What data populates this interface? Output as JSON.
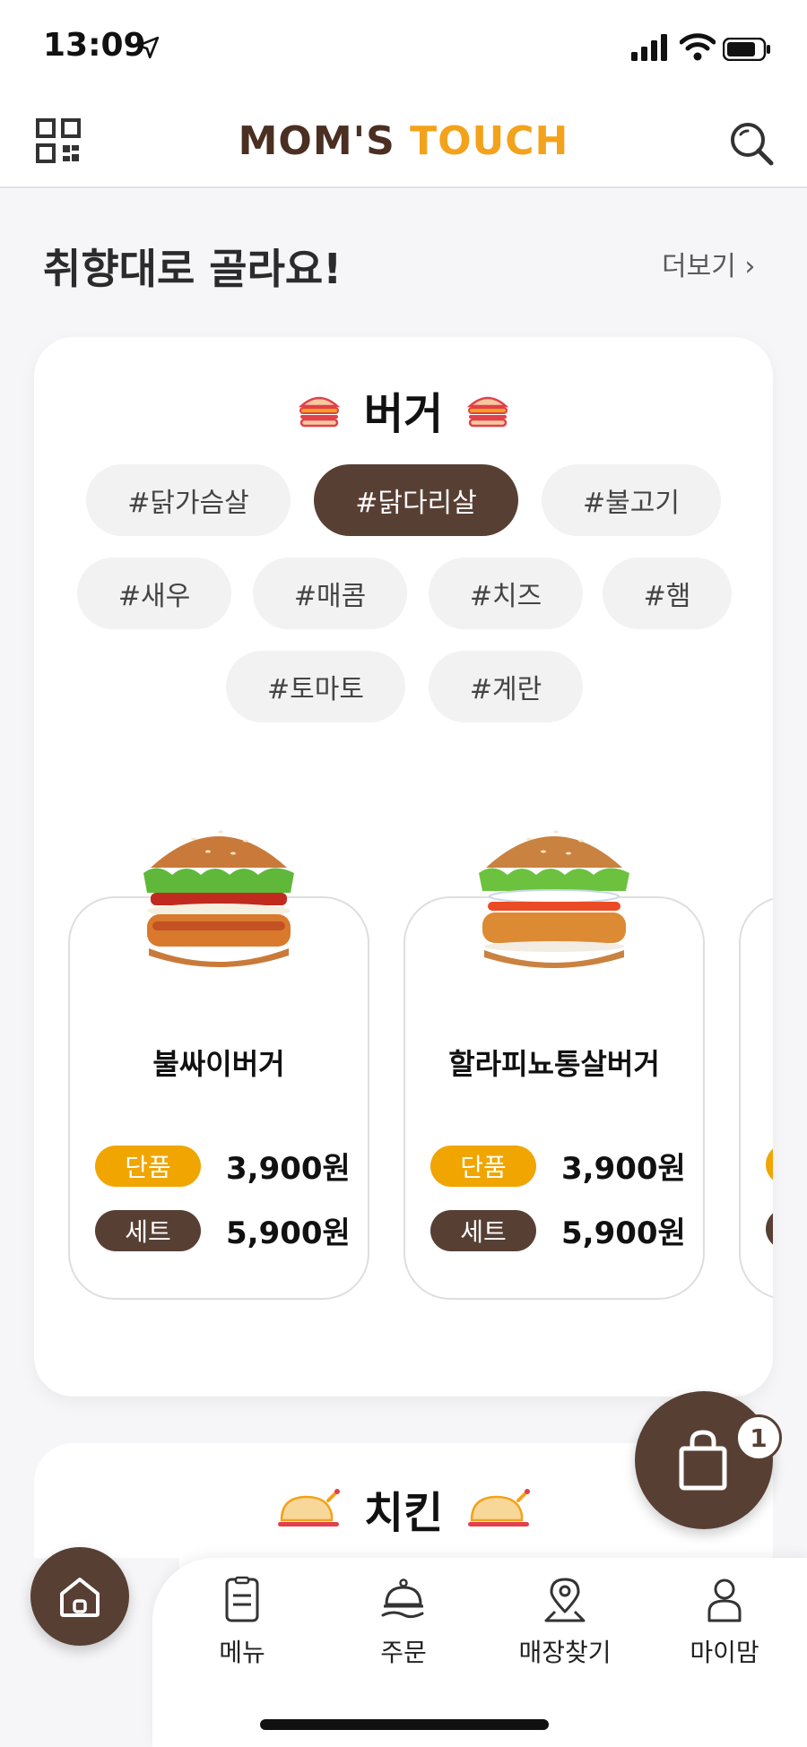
{
  "status_bar": {
    "time": "13:09"
  },
  "header": {
    "brand_part1": "MOM'S",
    "brand_part2": "TOUCH"
  },
  "section": {
    "title": "취향대로 골라요!",
    "more": "더보기 ›"
  },
  "burger_category": {
    "title": "버거",
    "tags": [
      {
        "label": "#닭가슴살",
        "active": false
      },
      {
        "label": "#닭다리살",
        "active": true
      },
      {
        "label": "#불고기",
        "active": false
      },
      {
        "label": "#새우",
        "active": false
      },
      {
        "label": "#매콤",
        "active": false
      },
      {
        "label": "#치즈",
        "active": false
      },
      {
        "label": "#햄",
        "active": false
      },
      {
        "label": "#토마토",
        "active": false
      },
      {
        "label": "#계란",
        "active": false
      }
    ],
    "items": [
      {
        "name": "불싸이버거",
        "single_label": "단품",
        "single_price": "3,900원",
        "set_label": "세트",
        "set_price": "5,900원"
      },
      {
        "name": "할라피뇨통살버거",
        "single_label": "단품",
        "single_price": "3,900원",
        "set_label": "세트",
        "set_price": "5,900원"
      }
    ]
  },
  "chicken_category": {
    "title": "치킨"
  },
  "cart": {
    "count": "1"
  },
  "bottom_nav": {
    "items": [
      {
        "label": "메뉴",
        "icon": "menu-icon"
      },
      {
        "label": "주문",
        "icon": "order-cloche-icon"
      },
      {
        "label": "매장찾기",
        "icon": "store-location-icon"
      },
      {
        "label": "마이맘",
        "icon": "person-icon"
      }
    ]
  },
  "colors": {
    "brand_brown": "#583f34",
    "brand_orange": "#f3a21b",
    "single_tag": "#f0a500"
  }
}
